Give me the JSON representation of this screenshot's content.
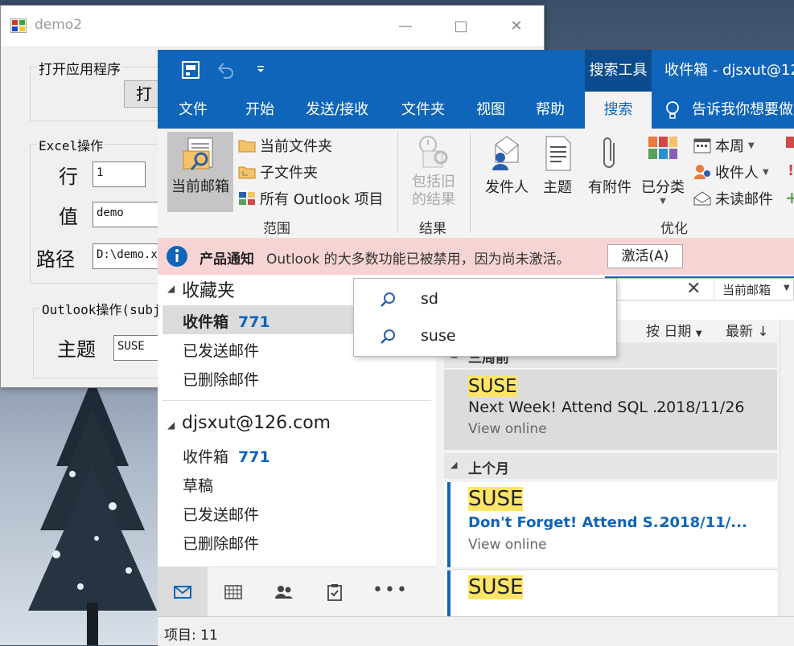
{
  "demo2": {
    "title": "demo2",
    "open_group": "打开应用程序",
    "open_button": "打",
    "excel_group": "Excel操作",
    "row_label": "行",
    "row_value": "1",
    "value_label": "值",
    "value_value": "demo",
    "path_label": "路径",
    "path_value": "D:\\demo.x",
    "outlook_group": "Outlook操作(subj",
    "subject_label": "主题",
    "subject_value": "SUSE"
  },
  "outlook": {
    "search_tools": "搜索工具",
    "title": "收件箱 - djsxut@12",
    "tabs": [
      "文件",
      "开始",
      "发送/接收",
      "文件夹",
      "视图",
      "帮助",
      "搜索"
    ],
    "tell_me": "告诉我你想要做",
    "ribbon": {
      "current_mailbox": "当前邮箱",
      "current_folder": "当前文件夹",
      "subfolders": "子文件夹",
      "all_items": "所有 Outlook 项目",
      "scope": "范围",
      "include_old_1": "包括旧",
      "include_old_2": "的结果",
      "results": "结果",
      "from": "发件人",
      "subject": "主题",
      "has_attachments": "有附件",
      "categorized": "已分类",
      "this_week": "本周",
      "sent_to": "收件人",
      "unread": "未读邮件",
      "refine": "优化"
    },
    "notice": {
      "title": "产品通知",
      "text": "Outlook 的大多数功能已被禁用，因为尚未激活。",
      "button": "激活(A)"
    },
    "nav": {
      "favorites": "收藏夹",
      "fav_inbox": "收件箱",
      "fav_inbox_count": "771",
      "fav_sent": "已发送邮件",
      "fav_deleted": "已删除邮件",
      "account": "djsxut@126.com",
      "inbox": "收件箱",
      "inbox_count": "771",
      "drafts": "草稿",
      "sent": "已发送邮件",
      "deleted": "已删除邮件"
    },
    "search": {
      "scope": "当前邮箱",
      "suggestions": [
        "sd",
        "suse"
      ]
    },
    "list": {
      "sort": "按 日期",
      "order": "最新",
      "groups": [
        {
          "header": "三周前",
          "messages": [
            {
              "subject": "SUSE",
              "preview": "Next Week! Attend SQL ...",
              "date": "2018/11/26",
              "snippet": "View online"
            }
          ]
        },
        {
          "header": "上个月",
          "messages": [
            {
              "subject": "SUSE",
              "preview": "Don't Forget! Attend S...",
              "date": "2018/11/...",
              "snippet": "View online"
            },
            {
              "subject": "SUSE"
            }
          ]
        }
      ]
    },
    "status": "项目: 11"
  }
}
